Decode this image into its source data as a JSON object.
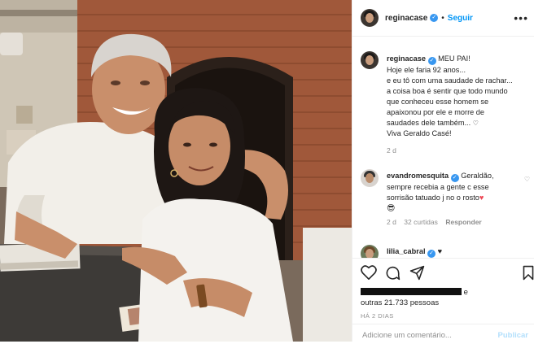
{
  "post": {
    "username": "reginacase",
    "follow_label": "Seguir",
    "more_label": "•••",
    "caption": {
      "first_line_suffix": " MEU PAI!",
      "lines": [
        "Hoje ele faria 92 anos...",
        "e eu tô com uma saudade de rachar...",
        "a coisa boa é sentir que todo mundo",
        "que conheceu esse homem se",
        "apaixonou por ele e morre de",
        "saudades dele também..."
      ],
      "last_line": "Viva Geraldo Casé!",
      "time": "2 d"
    },
    "comments": [
      {
        "username": "evandromesquita",
        "lines": [
          "Geraldão,",
          "sempre recebia a gente c esse",
          "sorrisão tatuado j no o rosto"
        ],
        "time": "2 d",
        "likes": "32 curtidas",
        "reply_label": "Responder"
      },
      {
        "username": "lilia_cabral",
        "lines": [
          "♥"
        ]
      }
    ],
    "likes_suffix": "e",
    "likes_line2": "outras 21.733 pessoas",
    "posted_ago": "HÁ 2 DIAS",
    "comment_placeholder": "Adicione um comentário...",
    "publish_label": "Publicar"
  },
  "icons": {
    "verified": "verified-badge",
    "like": "heart-outline-icon",
    "comment": "speech-bubble-icon",
    "share": "paper-plane-icon",
    "save": "bookmark-icon"
  },
  "colors": {
    "link_blue": "#0095f6",
    "verified_blue": "#3897f0",
    "heart_red": "#ed4956",
    "muted": "#8e8e8e"
  }
}
